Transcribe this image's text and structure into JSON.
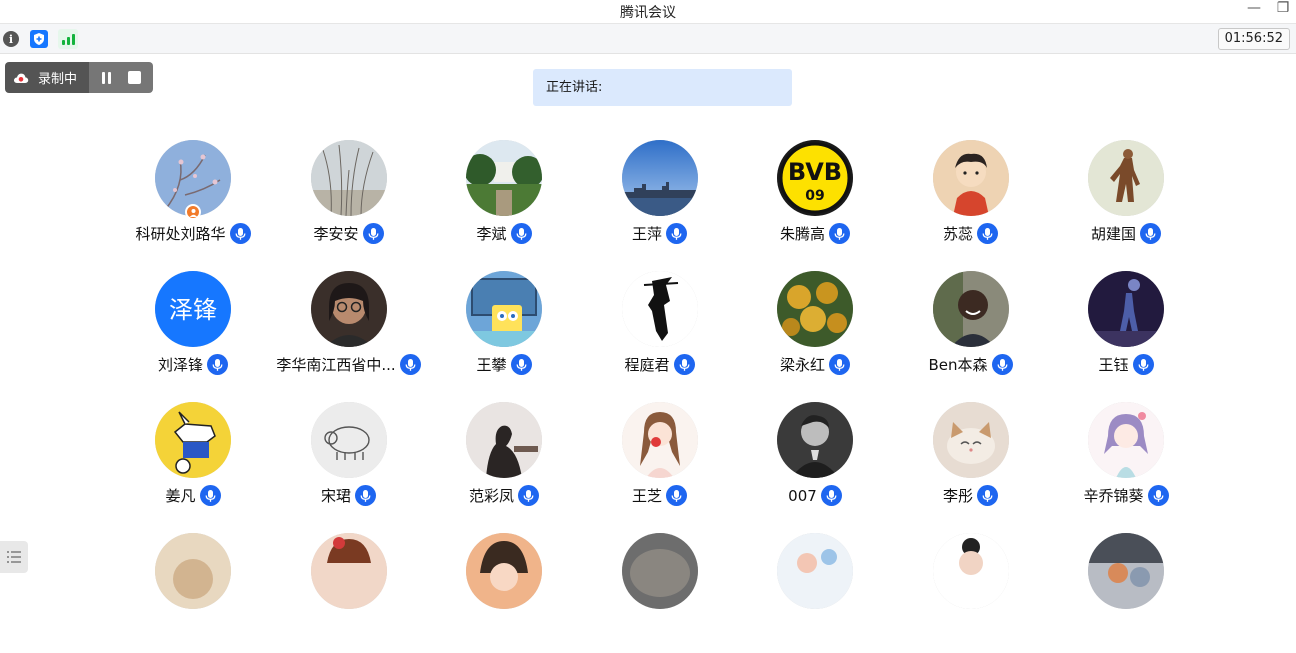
{
  "window": {
    "title": "腾讯会议",
    "minimize_glyph": "—",
    "restore_glyph": "❐"
  },
  "toolbar": {
    "info_icon_glyph": "i",
    "timer": "01:56:52"
  },
  "recording": {
    "label": "录制中"
  },
  "speaking": {
    "label": "正在讲话:"
  },
  "participants": [
    {
      "name": "科研处刘路华",
      "host": true,
      "avatar": "plum-blossom"
    },
    {
      "name": "李安安",
      "host": false,
      "avatar": "reeds"
    },
    {
      "name": "李斌",
      "host": false,
      "avatar": "garden-house"
    },
    {
      "name": "王萍",
      "host": false,
      "avatar": "city-skyline"
    },
    {
      "name": "朱腾高",
      "host": false,
      "avatar": "bvb-logo",
      "avatar_text": [
        "BVB",
        "09"
      ]
    },
    {
      "name": "苏蕊",
      "host": false,
      "avatar": "cartoon-child"
    },
    {
      "name": "胡建国",
      "host": false,
      "avatar": "warrior"
    },
    {
      "name": "刘泽锋",
      "host": false,
      "avatar": "text-avatar",
      "avatar_text": [
        "泽锋"
      ]
    },
    {
      "name": "李华南江西省中...",
      "host": false,
      "avatar": "woman-glasses"
    },
    {
      "name": "王攀",
      "host": false,
      "avatar": "sponge-cartoon"
    },
    {
      "name": "程庭君",
      "host": false,
      "avatar": "ink-figure"
    },
    {
      "name": "梁永红",
      "host": false,
      "avatar": "fruits"
    },
    {
      "name": "Ben本森",
      "host": false,
      "avatar": "smiling-man"
    },
    {
      "name": "王钰",
      "host": false,
      "avatar": "night-street"
    },
    {
      "name": "姜凡",
      "host": false,
      "avatar": "cartoon-dog"
    },
    {
      "name": "宋珺",
      "host": false,
      "avatar": "pig-sketch"
    },
    {
      "name": "范彩凤",
      "host": false,
      "avatar": "silhouette"
    },
    {
      "name": "王芝",
      "host": false,
      "avatar": "anime-girl"
    },
    {
      "name": "007",
      "host": false,
      "avatar": "bw-portrait"
    },
    {
      "name": "李彤",
      "host": false,
      "avatar": "cat"
    },
    {
      "name": "辛乔锦葵",
      "host": false,
      "avatar": "anime-purple"
    },
    {
      "name": "",
      "host": false,
      "avatar": "partial-1"
    },
    {
      "name": "",
      "host": false,
      "avatar": "partial-2"
    },
    {
      "name": "",
      "host": false,
      "avatar": "partial-3"
    },
    {
      "name": "",
      "host": false,
      "avatar": "partial-4"
    },
    {
      "name": "",
      "host": false,
      "avatar": "partial-5"
    },
    {
      "name": "",
      "host": false,
      "avatar": "partial-6"
    },
    {
      "name": "",
      "host": false,
      "avatar": "partial-7"
    }
  ],
  "colors": {
    "accent": "#1e66f0",
    "speaking_bg": "#dbe9fd",
    "host_badge": "#f27b2a"
  }
}
